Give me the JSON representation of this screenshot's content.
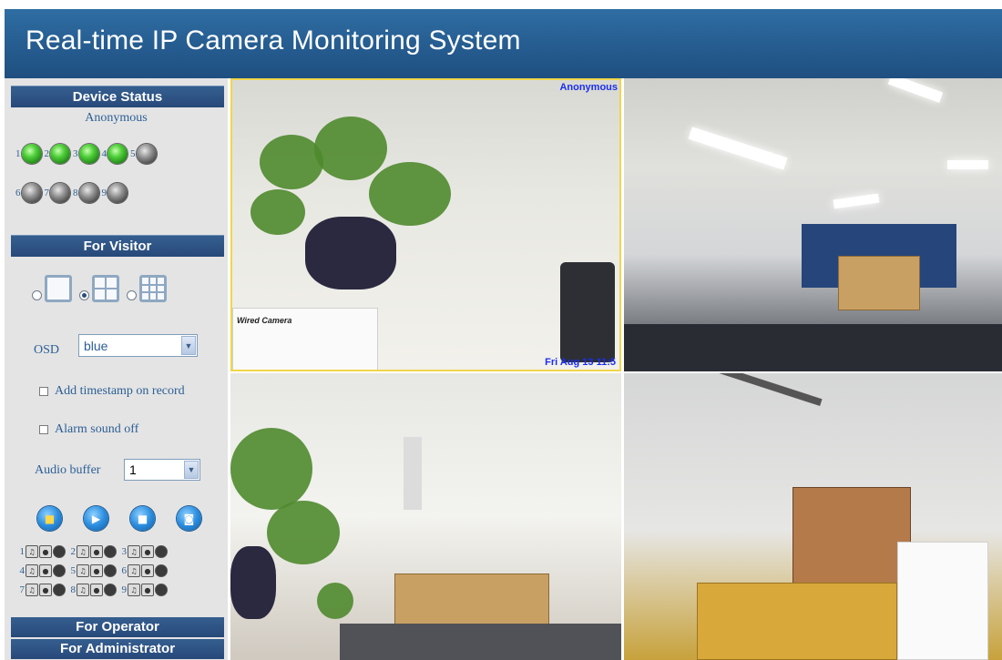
{
  "header": {
    "title": "Real-time IP Camera Monitoring System"
  },
  "sidebar": {
    "device_status": {
      "title": "Device Status",
      "user": "Anonymous",
      "devices": [
        {
          "num": "1",
          "state": "online"
        },
        {
          "num": "2",
          "state": "online"
        },
        {
          "num": "3",
          "state": "online"
        },
        {
          "num": "4",
          "state": "online"
        },
        {
          "num": "5",
          "state": "offline"
        },
        {
          "num": "6",
          "state": "offline"
        },
        {
          "num": "7",
          "state": "offline"
        },
        {
          "num": "8",
          "state": "offline"
        },
        {
          "num": "9",
          "state": "offline"
        }
      ]
    },
    "visitor": {
      "title": "For Visitor",
      "layout_selected": "4-grid",
      "osd_label": "OSD",
      "osd_value": "blue",
      "timestamp_label": "Add timestamp on record",
      "alarm_label": "Alarm sound off",
      "audio_label": "Audio buffer",
      "audio_value": "1",
      "channel_numbers": [
        "1",
        "2",
        "3",
        "4",
        "5",
        "6",
        "7",
        "8",
        "9"
      ]
    },
    "operator": {
      "title": "For Operator"
    },
    "administrator": {
      "title": "For Administrator"
    }
  },
  "cameras": {
    "cam1": {
      "name": "Anonymous",
      "time": "Fri Aug 13 11:5",
      "label": "Wired Camera"
    }
  },
  "colors": {
    "header": "#2f6ea3",
    "section_bar": "#2d5585",
    "led_on": "#4fcf3a",
    "led_off": "#6a6a6a",
    "overlay_text": "#1a2ef0"
  }
}
